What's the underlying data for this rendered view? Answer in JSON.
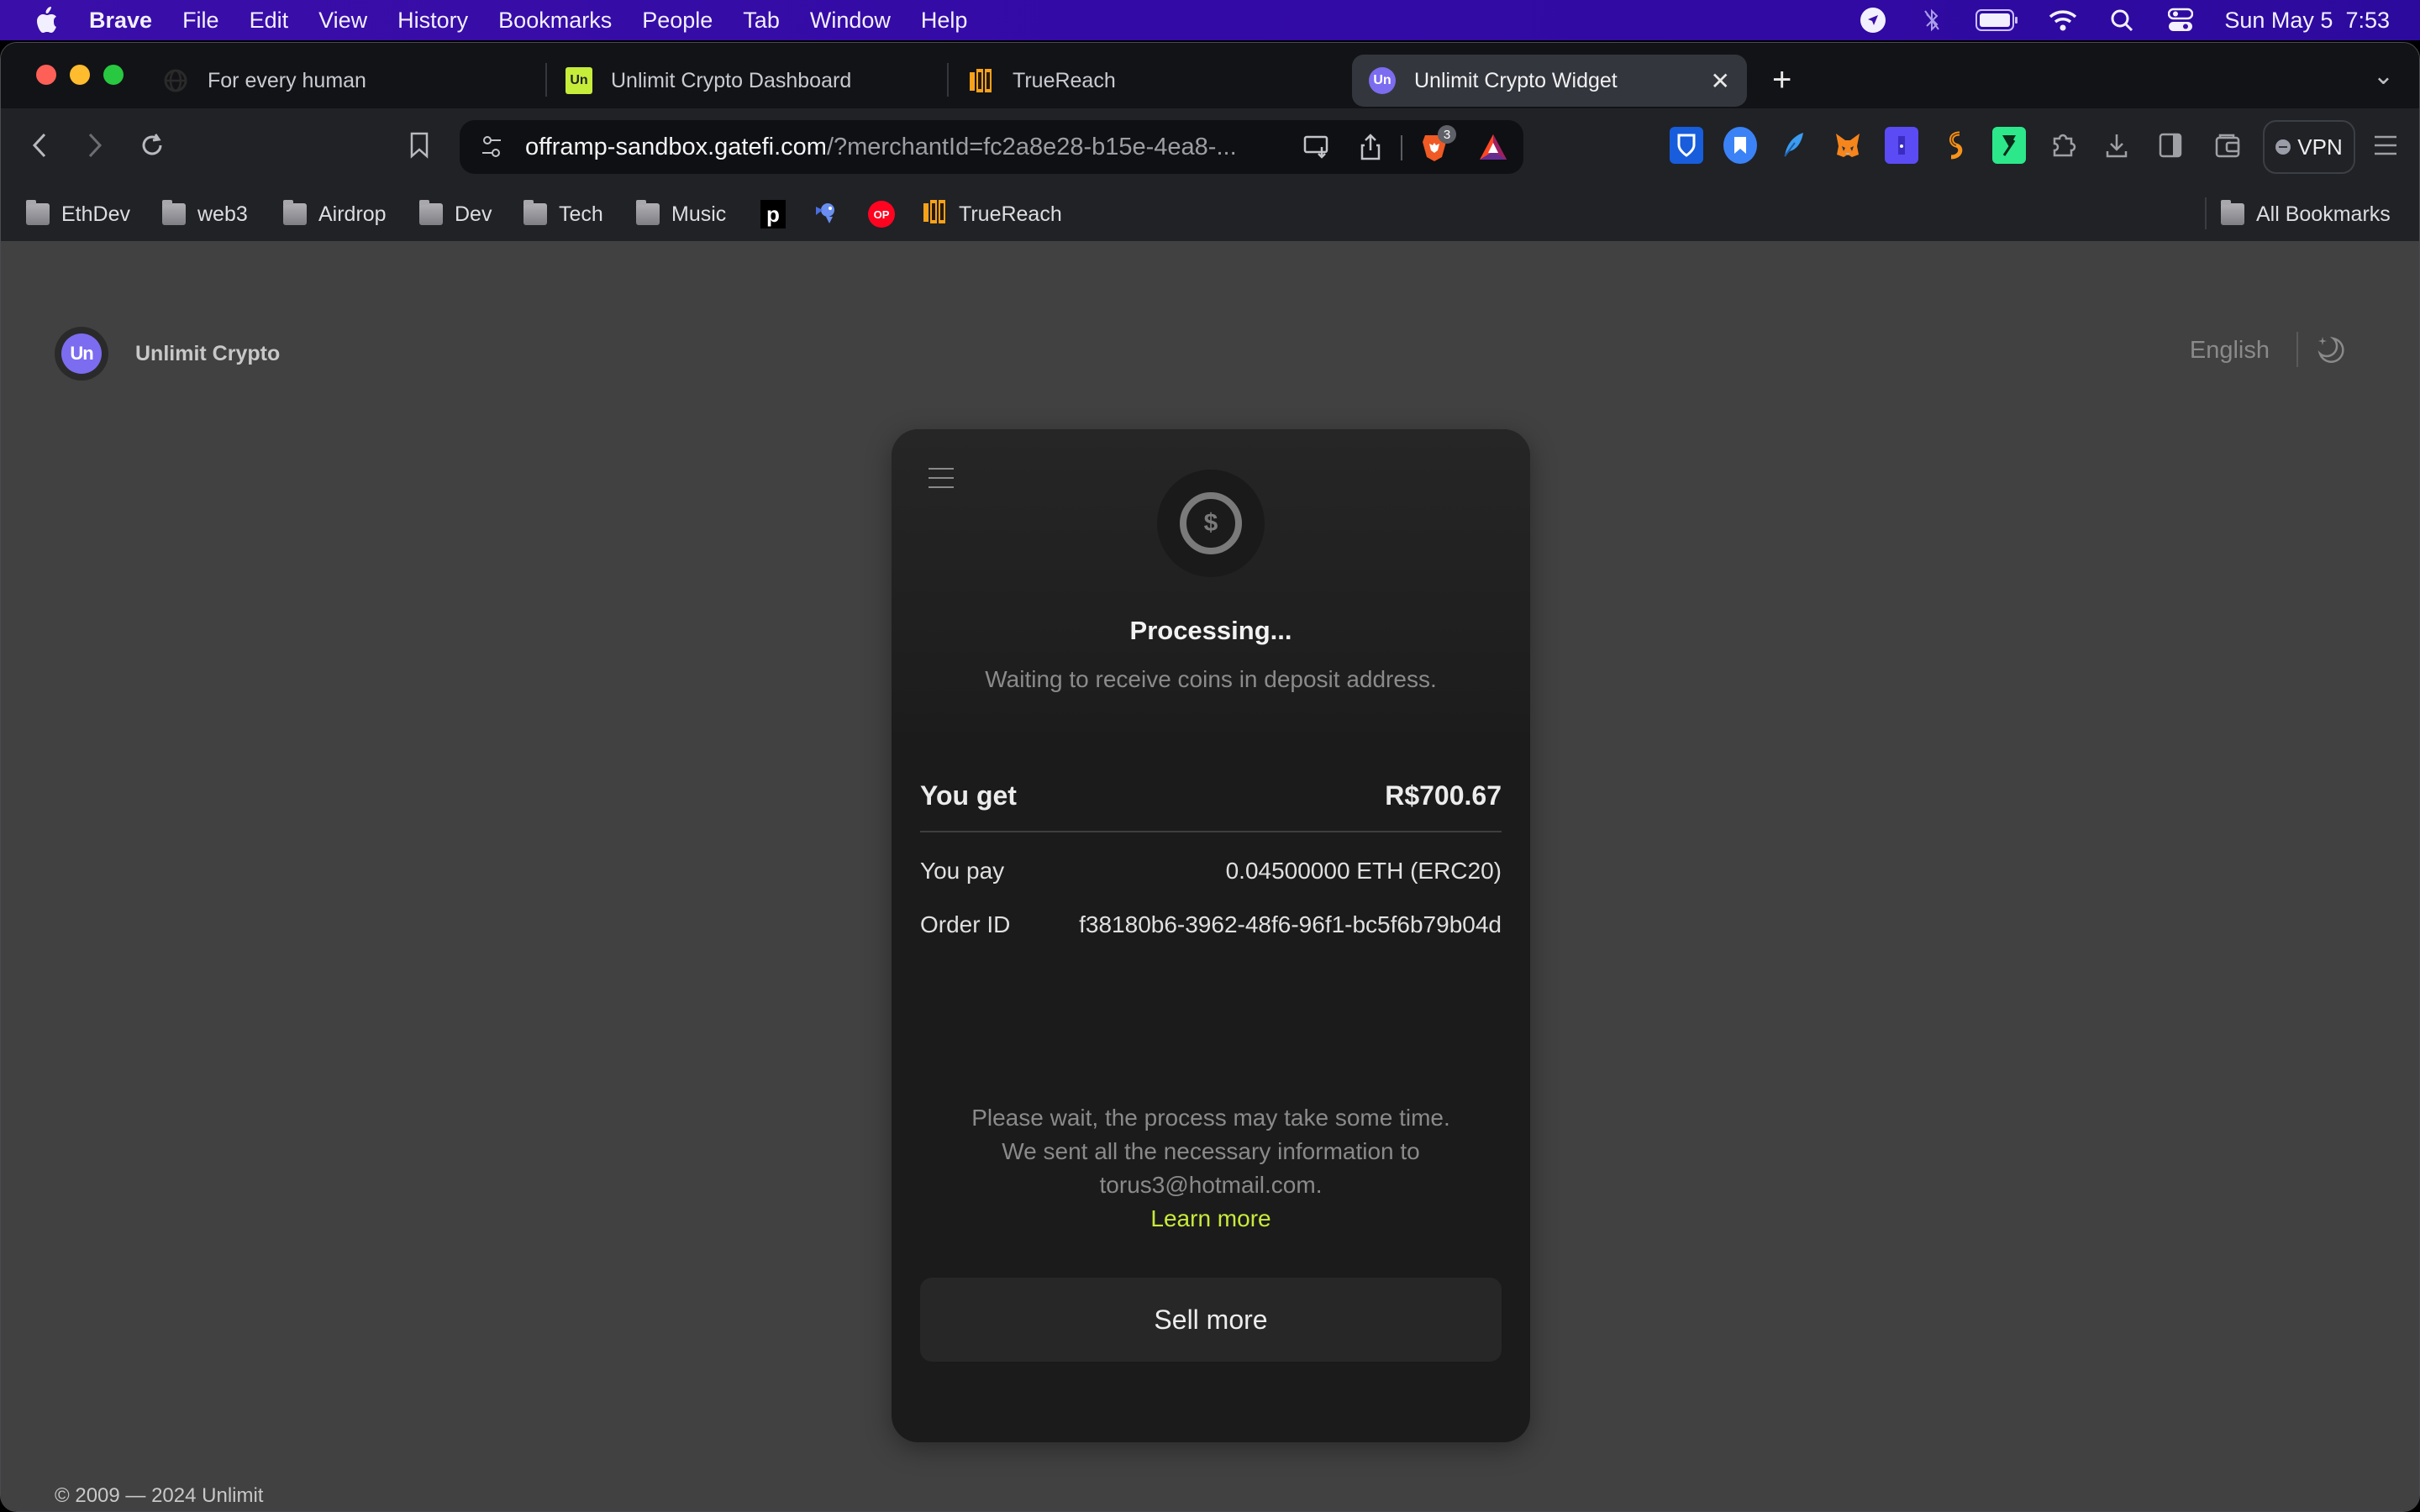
{
  "menubar": {
    "app_name": "Brave",
    "items": [
      "File",
      "Edit",
      "View",
      "History",
      "Bookmarks",
      "People",
      "Tab",
      "Window",
      "Help"
    ],
    "status_icons": [
      "location-icon",
      "bluetooth-off-icon",
      "battery-icon",
      "wifi-icon",
      "spotlight-search-icon",
      "control-center-icon"
    ],
    "datetime": "Sun May 5  7:53"
  },
  "tabs": [
    {
      "title": "For every human",
      "favicon": "globe-ring-icon",
      "active": false
    },
    {
      "title": "Unlimit Crypto Dashboard",
      "favicon": "unlimit-green-icon",
      "active": false
    },
    {
      "title": "TrueReach",
      "favicon": "truereach-icon",
      "active": false
    },
    {
      "title": "Unlimit Crypto Widget",
      "favicon": "unlimit-purple-icon",
      "active": true
    }
  ],
  "tab_close_glyph": "✕",
  "new_tab_glyph": "+",
  "tab_list_glyph": "⌄",
  "toolbar": {
    "url_host": "offramp-sandbox.gatefi.com",
    "url_rest": "/?merchantId=fc2a8e28-b15e-4ea8-...",
    "shields_count": "3",
    "vpn_label": "VPN"
  },
  "extensions": [
    "bitwarden-icon",
    "bookmark-ext-icon",
    "feather-ext-icon",
    "metamask-icon",
    "purple-ext-icon",
    "chain-ext-icon",
    "green-ext-icon",
    "puzzle-extensions-icon",
    "download-icon",
    "sidebar-icon",
    "wallet-icon"
  ],
  "bookmarks": {
    "items": [
      {
        "label": "EthDev",
        "type": "folder"
      },
      {
        "label": "web3",
        "type": "folder"
      },
      {
        "label": "Airdrop",
        "type": "folder"
      },
      {
        "label": "Dev",
        "type": "folder"
      },
      {
        "label": "Tech",
        "type": "folder"
      },
      {
        "label": "Music",
        "type": "folder"
      },
      {
        "label": "",
        "type": "p-site-icon"
      },
      {
        "label": "",
        "type": "bird-site-icon"
      },
      {
        "label": "",
        "type": "op-site-icon"
      },
      {
        "label": "TrueReach",
        "type": "truereach-icon"
      }
    ],
    "all_bookmarks": "All Bookmarks",
    "op_badge": "OP",
    "p_badge": "p"
  },
  "page": {
    "brand_logo_text": "Un",
    "brand_name": "Unlimit Crypto",
    "language": "English",
    "footer": "© 2009 — 2024 Unlimit",
    "accent_color": "#c8ea3c",
    "brand_color": "#7c6cf0"
  },
  "widget": {
    "coin_symbol": "$",
    "title": "Processing...",
    "subtitle": "Waiting to receive coins in deposit address.",
    "you_get_label": "You get",
    "you_get_value": "R$700.67",
    "you_pay_label": "You pay",
    "you_pay_value": "0.04500000 ETH (ERC20)",
    "order_id_label": "Order ID",
    "order_id_value": "f38180b6-3962-48f6-96f1-bc5f6b79b04d",
    "notice_line1": "Please wait, the process may take some time.",
    "notice_line2": "We sent all the necessary information to",
    "notice_email": "torus3@hotmail.com.",
    "learn_more": "Learn more",
    "sell_more": "Sell more"
  }
}
